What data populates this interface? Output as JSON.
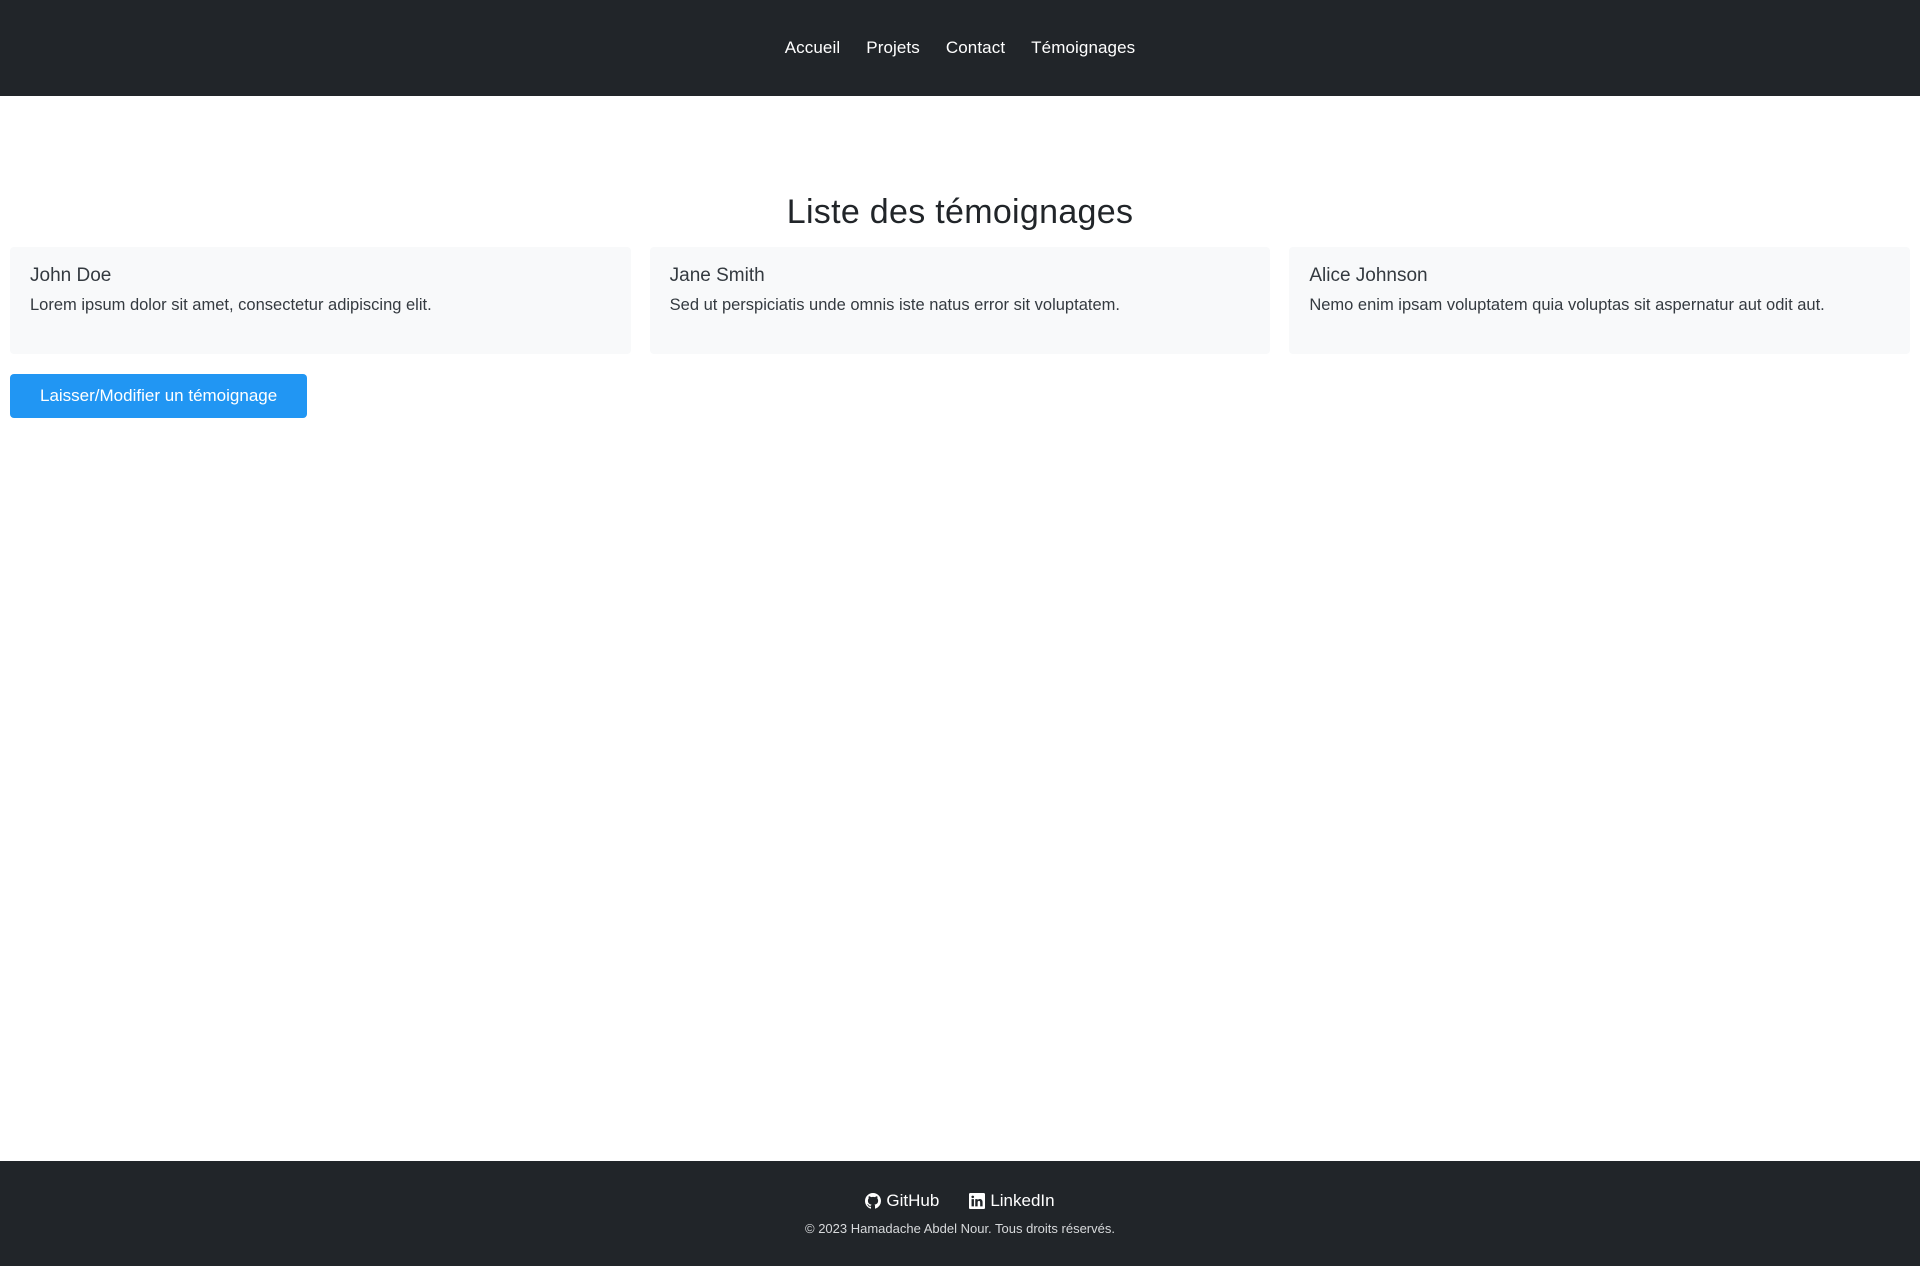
{
  "nav": {
    "items": [
      {
        "label": "Accueil"
      },
      {
        "label": "Projets"
      },
      {
        "label": "Contact"
      },
      {
        "label": "Témoignages"
      }
    ]
  },
  "main": {
    "title": "Liste des témoignages",
    "testimonials": [
      {
        "name": "John Doe",
        "text": "Lorem ipsum dolor sit amet, consectetur adipiscing elit."
      },
      {
        "name": "Jane Smith",
        "text": "Sed ut perspiciatis unde omnis iste natus error sit voluptatem."
      },
      {
        "name": "Alice Johnson",
        "text": "Nemo enim ipsam voluptatem quia voluptas sit aspernatur aut odit aut."
      }
    ],
    "button_label": "Laisser/Modifier un témoignage"
  },
  "footer": {
    "links": [
      {
        "label": "GitHub",
        "icon": "github-icon"
      },
      {
        "label": "LinkedIn",
        "icon": "linkedin-icon"
      }
    ],
    "copyright": "© 2023 Hamadache Abdel Nour. Tous droits réservés."
  },
  "colors": {
    "header_bg": "#212529",
    "card_bg": "#f8f9fa",
    "button_bg": "#2196f3"
  }
}
